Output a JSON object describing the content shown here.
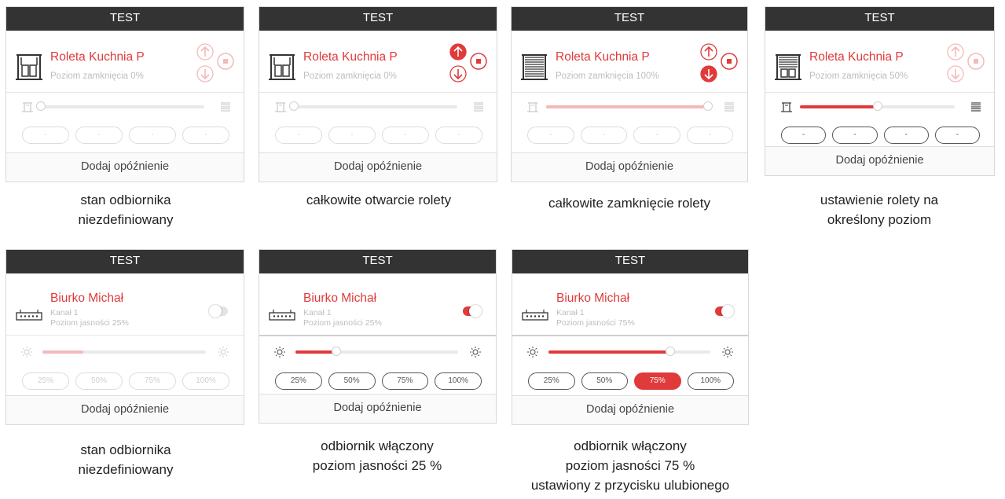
{
  "header_title": "TEST",
  "footer_label": "Dodaj opóźnienie",
  "colors": {
    "accent": "#e03a3a",
    "header": "#333333",
    "faded": "#f4b9b9"
  },
  "blinds": [
    {
      "name": "Roleta Kuchnia P",
      "status": "Poziom zamknięcia 0%",
      "level": 0,
      "state": "undefined",
      "up_active": false,
      "down_active": false,
      "pills": [
        "-",
        "-",
        "-",
        "-"
      ],
      "caption": [
        "stan odbiornika",
        "niezdefiniowany"
      ]
    },
    {
      "name": "Roleta Kuchnia P",
      "status": "Poziom zamknięcia 0%",
      "level": 0,
      "state": "opening",
      "up_active": true,
      "down_active": false,
      "pills": [
        "-",
        "-",
        "-",
        "-"
      ],
      "caption": [
        "całkowite otwarcie rolety"
      ]
    },
    {
      "name": "Roleta Kuchnia P",
      "status": "Poziom zamknięcia 100%",
      "level": 1.0,
      "state": "closing",
      "up_active": false,
      "down_active": true,
      "pills": [
        "-",
        "-",
        "-",
        "-"
      ],
      "caption": [
        "całkowite zamknięcie rolety"
      ]
    },
    {
      "name": "Roleta Kuchnia P",
      "status": "Poziom zamknięcia 50%",
      "level": 0.5,
      "state": "level",
      "up_active": false,
      "down_active": false,
      "pills": [
        "-",
        "-",
        "-",
        "-"
      ],
      "caption": [
        "ustawienie  rolety na",
        "określony poziom"
      ]
    }
  ],
  "dimmers": [
    {
      "name": "Biurko Michał",
      "channel": "Kanał 1",
      "status": "Poziom jasności 25%",
      "level": 0.25,
      "state": "undefined",
      "on": false,
      "active_pill": -1,
      "pills": [
        "25%",
        "50%",
        "75%",
        "100%"
      ],
      "caption": [
        "stan odbiornika",
        "niezdefiniowany"
      ]
    },
    {
      "name": "Biurko Michał",
      "channel": "Kanał 1",
      "status": "Poziom jasności 25%",
      "level": 0.25,
      "state": "on",
      "on": true,
      "active_pill": -1,
      "pills": [
        "25%",
        "50%",
        "75%",
        "100%"
      ],
      "caption": [
        "odbiornik włączony",
        "poziom jasności 25 %"
      ]
    },
    {
      "name": "Biurko Michał",
      "channel": "Kanał 1",
      "status": "Poziom jasności 75%",
      "level": 0.75,
      "state": "on",
      "on": true,
      "active_pill": 2,
      "pills": [
        "25%",
        "50%",
        "75%",
        "100%"
      ],
      "caption": [
        "odbiornik włączony",
        "poziom jasności 75 %",
        "ustawiony z przycisku ulubionego"
      ]
    }
  ]
}
